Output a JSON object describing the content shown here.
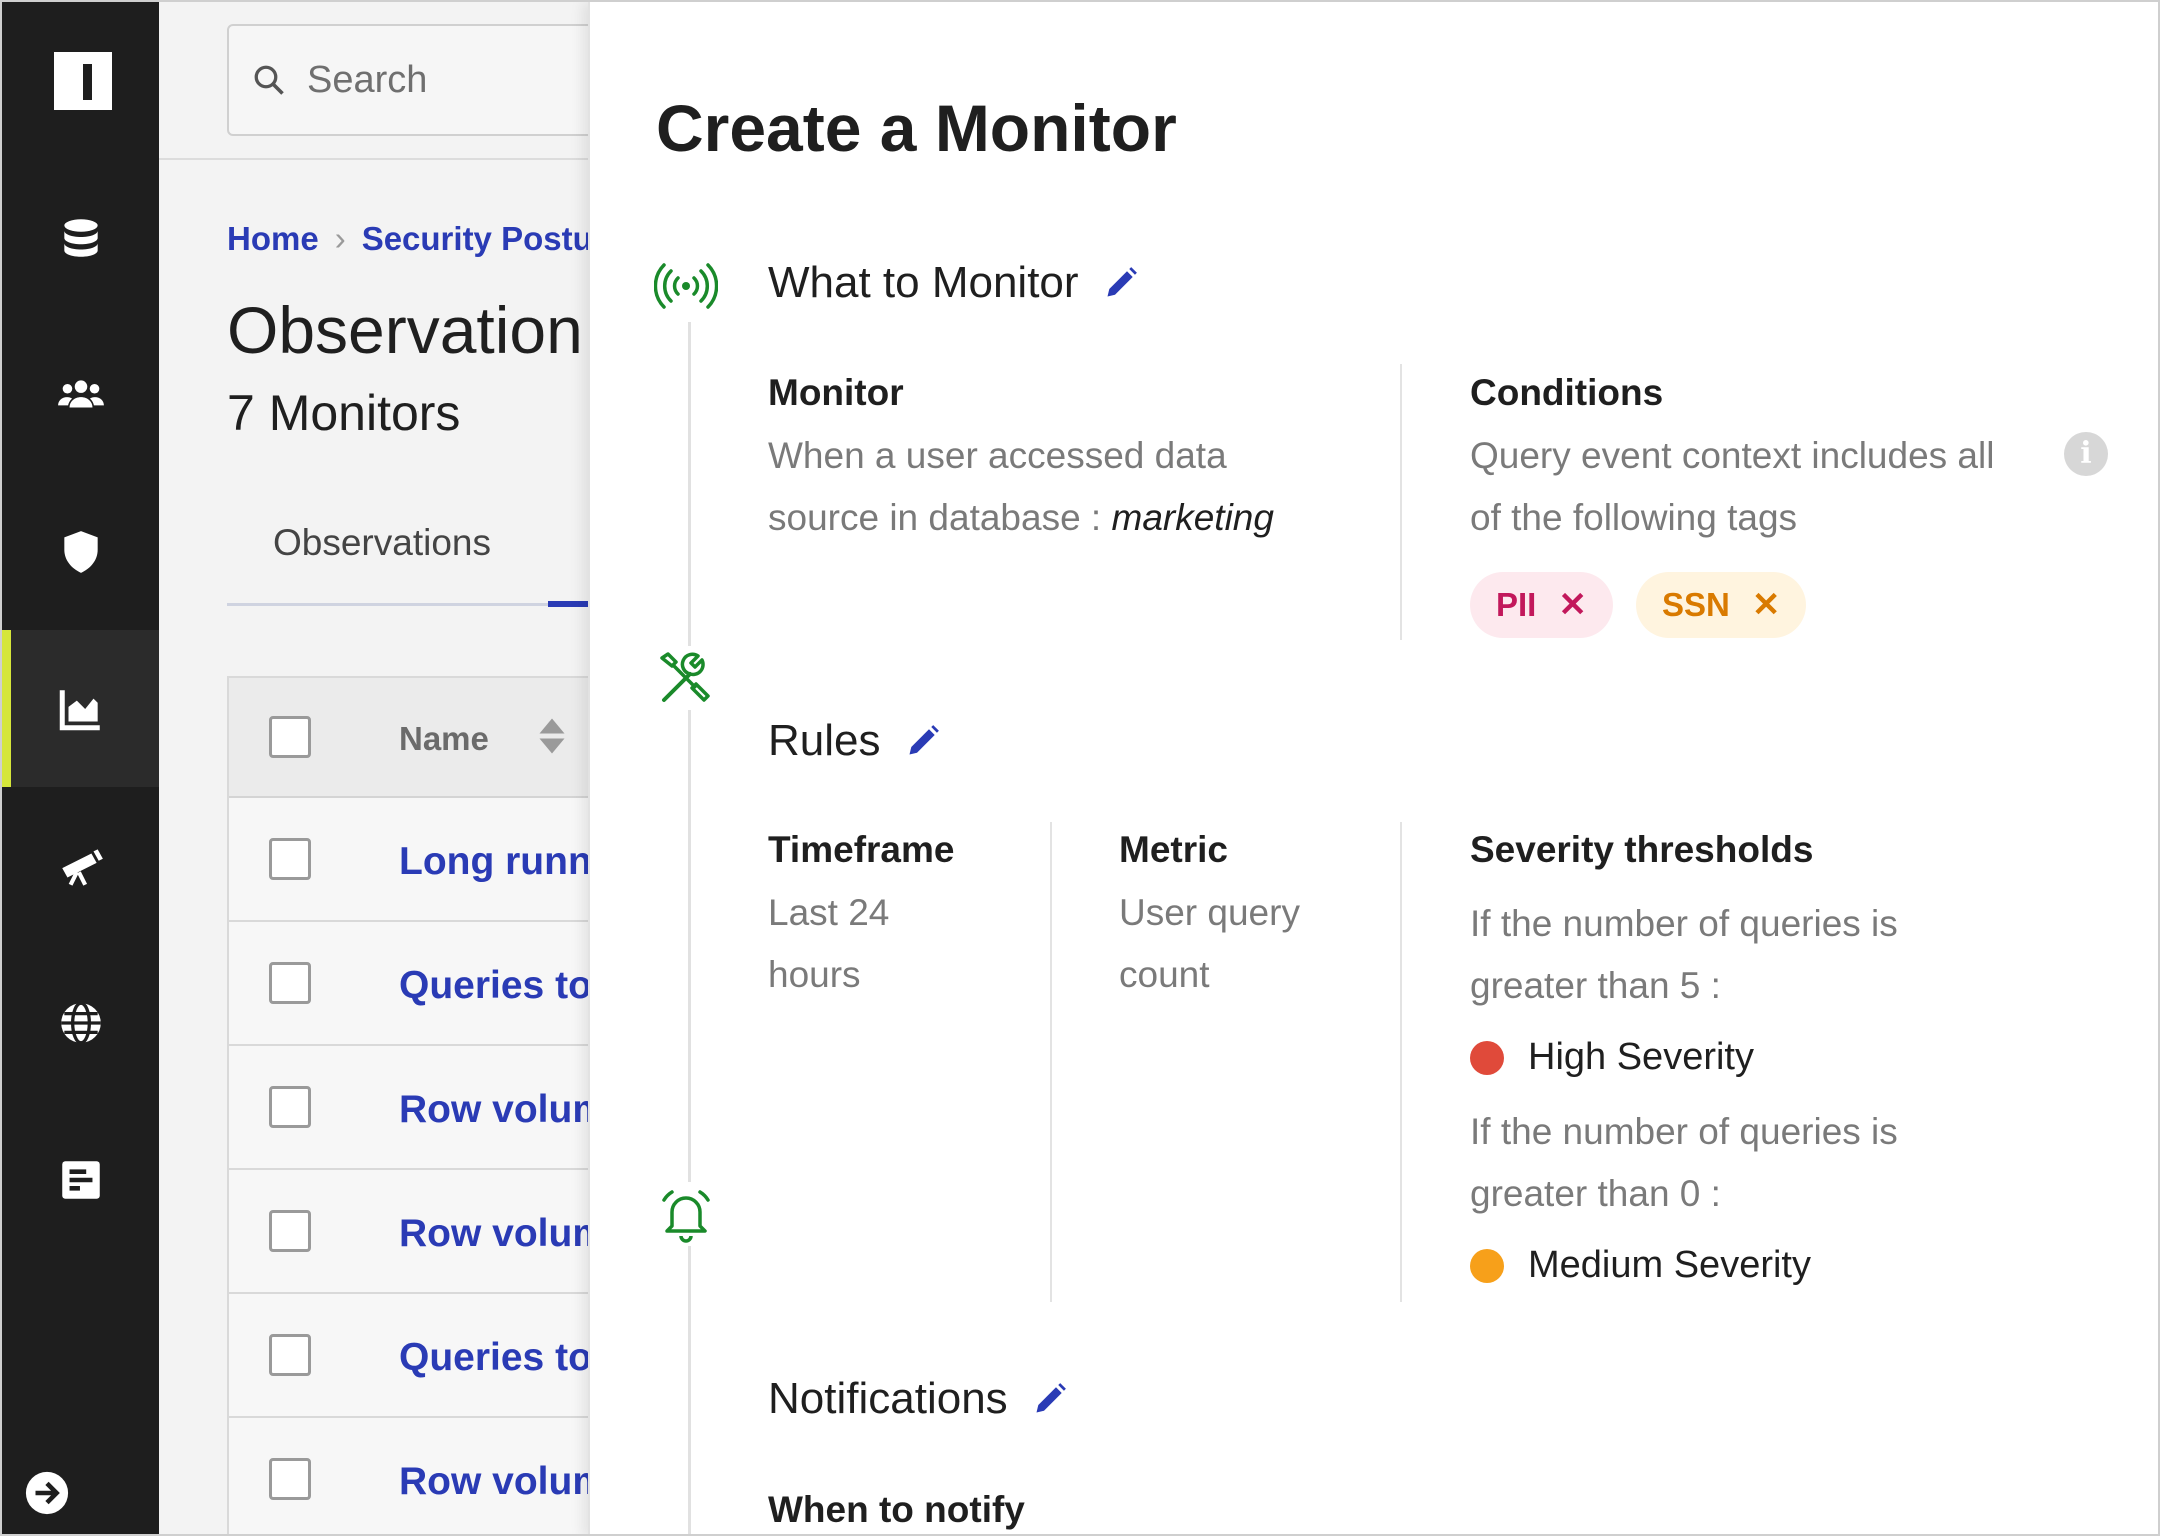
{
  "nav": {
    "items": [
      "data-sources-icon",
      "users-icon",
      "security-icon",
      "observations-icon",
      "explore-icon",
      "global-icon",
      "reports-icon"
    ],
    "active": "observations-icon",
    "expand": "expand-arrow-icon"
  },
  "search": {
    "placeholder": "Search"
  },
  "breadcrumb": {
    "home": "Home",
    "current": "Security Postu"
  },
  "page": {
    "title": "Observation",
    "subtitle": "7 Monitors"
  },
  "tabs": {
    "observations": "Observations"
  },
  "table": {
    "header_name": "Name",
    "rows": [
      "Long runni",
      "Queries to",
      "Row volum",
      "Row volum",
      "Queries to",
      "Row volum"
    ]
  },
  "panel": {
    "title": "Create a Monitor",
    "what": {
      "title": "What to Monitor",
      "monitor_label": "Monitor",
      "monitor_text_1": "When a user accessed data",
      "monitor_text_2": "source in database :",
      "monitor_db": "marketing",
      "conditions_label": "Conditions",
      "conditions_text_1": "Query event context includes all",
      "conditions_text_2": "of the following tags",
      "tags": [
        {
          "label": "PII",
          "text_color": "#c2185b",
          "bg_color": "#fde9ee"
        },
        {
          "label": "SSN",
          "text_color": "#d97a00",
          "bg_color": "#fff4df"
        }
      ],
      "tag_remove": "✕"
    },
    "rules": {
      "title": "Rules",
      "timeframe_label": "Timeframe",
      "timeframe_1": "Last 24",
      "timeframe_2": "hours",
      "metric_label": "Metric",
      "metric_1": "User query",
      "metric_2": "count",
      "severity_label": "Severity thresholds",
      "high_cond_1": "If the number of queries is",
      "high_cond_2": "greater than 5 :",
      "high_label": "High Severity",
      "high_color": "#e04a3a",
      "medium_cond_1": "If the number of queries is",
      "medium_cond_2": "greater than 0 :",
      "medium_label": "Medium Severity",
      "medium_color": "#f7a01a"
    },
    "notifications": {
      "title": "Notifications",
      "when_label": "When to notify"
    }
  },
  "colors": {
    "accent": "#2a3bb5",
    "step_green": "#1a8a2a",
    "rail_active": "#d5e63a"
  }
}
